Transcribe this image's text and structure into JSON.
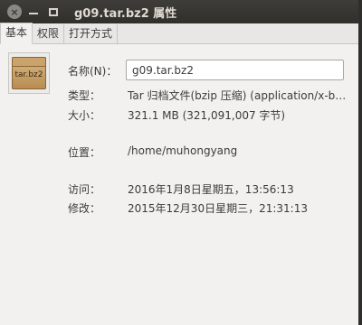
{
  "window": {
    "title": "g09.tar.bz2 属性",
    "close_glyph": "×"
  },
  "tabs": [
    {
      "label": "基本"
    },
    {
      "label": "权限"
    },
    {
      "label": "打开方式"
    }
  ],
  "icon": {
    "name": "archive-icon",
    "caption": "tar.bz2"
  },
  "fields": {
    "name": {
      "label": "名称(N)：",
      "value": "g09.tar.bz2"
    },
    "type": {
      "label": "类型：",
      "value": "Tar 归档文件(bzip 压缩) (application/x-bzip-compressed-tar)"
    },
    "size": {
      "label": "大小：",
      "value": "321.1 MB (321,091,007 字节)"
    },
    "location": {
      "label": "位置：",
      "value": "/home/muhongyang"
    },
    "accessed": {
      "label": "访问：",
      "value": "2016年1月8日星期五，13:56:13"
    },
    "modified": {
      "label": "修改：",
      "value": "2015年12月30日星期三，21:31:13"
    }
  }
}
